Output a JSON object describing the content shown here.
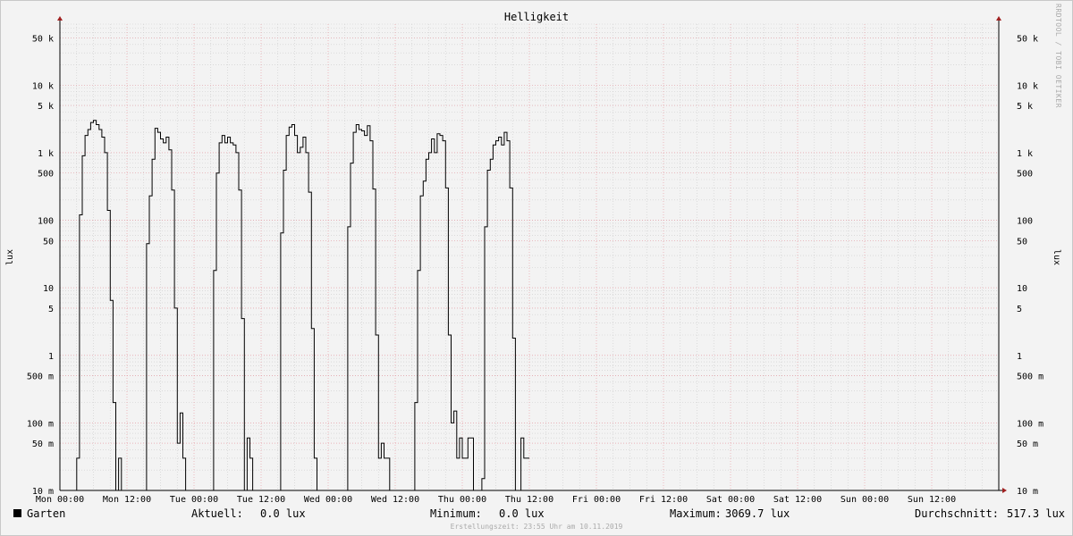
{
  "window": {
    "credit": "RRDTOOL / TOBI OETIKER",
    "footer": "Erstellungszeit: 23:55 Uhr am 10.11.2019"
  },
  "legend": {
    "series_name": "Garten",
    "current_label": "Aktuell:",
    "current_value": "0.0 lux",
    "min_label": "Minimum:",
    "min_value": "0.0 lux",
    "max_label": "Maximum:",
    "max_value": "3069.7 lux",
    "avg_label": "Durchschnitt:",
    "avg_value": "517.3 lux"
  },
  "chart_data": {
    "type": "line",
    "title": "Helligkeit",
    "ylabel": "lux",
    "yscale": "log",
    "ylim": [
      0.01,
      80000
    ],
    "xlim_hours": [
      0,
      168
    ],
    "ytick_values": [
      0.01,
      0.05,
      0.1,
      0.5,
      1,
      5,
      10,
      50,
      100,
      500,
      1000,
      5000,
      10000,
      50000
    ],
    "ytick_labels": [
      "10 m",
      "50 m",
      "100 m",
      "500 m",
      "1",
      "5",
      "10",
      "50",
      "100",
      "500",
      "1 k",
      "5 k",
      "10 k",
      "50 k"
    ],
    "xtick_values": [
      0,
      12,
      24,
      36,
      48,
      60,
      72,
      84,
      96,
      108,
      120,
      132,
      144,
      156
    ],
    "xtick_labels": [
      "Mon 00:00",
      "Mon 12:00",
      "Tue 00:00",
      "Tue 12:00",
      "Wed 00:00",
      "Wed 12:00",
      "Thu 00:00",
      "Thu 12:00",
      "Fri 00:00",
      "Fri 12:00",
      "Sat 00:00",
      "Sat 12:00",
      "Sun 00:00",
      "Sun 12:00"
    ],
    "grid": true,
    "colors": {
      "line": "#000000",
      "major_grid": "#e8a0a8",
      "minor_grid": "#cccccc",
      "axis": "#000000",
      "arrow": "#a02020"
    },
    "series": [
      {
        "name": "Garten",
        "points": [
          [
            0,
            0.01
          ],
          [
            3,
            0.01
          ],
          [
            3,
            0.03
          ],
          [
            3.5,
            0.03
          ],
          [
            3.5,
            120
          ],
          [
            4,
            120
          ],
          [
            4,
            900
          ],
          [
            4.5,
            900
          ],
          [
            4.5,
            1800
          ],
          [
            5,
            1800
          ],
          [
            5,
            2200
          ],
          [
            5.5,
            2200
          ],
          [
            5.5,
            2800
          ],
          [
            6,
            2800
          ],
          [
            6,
            3000
          ],
          [
            6.5,
            3000
          ],
          [
            6.5,
            2600
          ],
          [
            7,
            2600
          ],
          [
            7,
            2200
          ],
          [
            7.5,
            2200
          ],
          [
            7.5,
            1700
          ],
          [
            8,
            1700
          ],
          [
            8,
            1000
          ],
          [
            8.5,
            1000
          ],
          [
            8.5,
            140
          ],
          [
            9,
            140
          ],
          [
            9,
            6.5
          ],
          [
            9.5,
            6.5
          ],
          [
            9.5,
            0.2
          ],
          [
            10,
            0.2
          ],
          [
            10,
            0.01
          ],
          [
            10.5,
            0.01
          ],
          [
            10.5,
            0.03
          ],
          [
            11,
            0.03
          ],
          [
            11,
            0.01
          ],
          [
            15.5,
            0.01
          ],
          [
            15.5,
            45
          ],
          [
            16,
            45
          ],
          [
            16,
            230
          ],
          [
            16.5,
            230
          ],
          [
            16.5,
            800
          ],
          [
            17,
            800
          ],
          [
            17,
            2300
          ],
          [
            17.5,
            2300
          ],
          [
            17.5,
            2000
          ],
          [
            18,
            2000
          ],
          [
            18,
            1600
          ],
          [
            18.5,
            1600
          ],
          [
            18.5,
            1400
          ],
          [
            19,
            1400
          ],
          [
            19,
            1700
          ],
          [
            19.5,
            1700
          ],
          [
            19.5,
            1100
          ],
          [
            20,
            1100
          ],
          [
            20,
            280
          ],
          [
            20.5,
            280
          ],
          [
            20.5,
            5
          ],
          [
            21,
            5
          ],
          [
            21,
            0.05
          ],
          [
            21.5,
            0.05
          ],
          [
            21.5,
            0.14
          ],
          [
            22,
            0.14
          ],
          [
            22,
            0.03
          ],
          [
            22.5,
            0.03
          ],
          [
            22.5,
            0.01
          ],
          [
            27.5,
            0.01
          ],
          [
            27.5,
            18
          ],
          [
            28,
            18
          ],
          [
            28,
            500
          ],
          [
            28.5,
            500
          ],
          [
            28.5,
            1400
          ],
          [
            29,
            1400
          ],
          [
            29,
            1800
          ],
          [
            29.5,
            1800
          ],
          [
            29.5,
            1400
          ],
          [
            30,
            1400
          ],
          [
            30,
            1700
          ],
          [
            30.5,
            1700
          ],
          [
            30.5,
            1400
          ],
          [
            31,
            1400
          ],
          [
            31,
            1300
          ],
          [
            31.5,
            1300
          ],
          [
            31.5,
            1000
          ],
          [
            32,
            1000
          ],
          [
            32,
            280
          ],
          [
            32.5,
            280
          ],
          [
            32.5,
            3.5
          ],
          [
            33,
            3.5
          ],
          [
            33,
            0.01
          ],
          [
            33.5,
            0.01
          ],
          [
            33.5,
            0.06
          ],
          [
            34,
            0.06
          ],
          [
            34,
            0.03
          ],
          [
            34.5,
            0.03
          ],
          [
            34.5,
            0.01
          ],
          [
            39.5,
            0.01
          ],
          [
            39.5,
            65
          ],
          [
            40,
            65
          ],
          [
            40,
            550
          ],
          [
            40.5,
            550
          ],
          [
            40.5,
            1800
          ],
          [
            41,
            1800
          ],
          [
            41,
            2400
          ],
          [
            41.5,
            2400
          ],
          [
            41.5,
            2600
          ],
          [
            42,
            2600
          ],
          [
            42,
            1800
          ],
          [
            42.5,
            1800
          ],
          [
            42.5,
            1000
          ],
          [
            43,
            1000
          ],
          [
            43,
            1200
          ],
          [
            43.5,
            1200
          ],
          [
            43.5,
            1700
          ],
          [
            44,
            1700
          ],
          [
            44,
            1000
          ],
          [
            44.5,
            1000
          ],
          [
            44.5,
            260
          ],
          [
            45,
            260
          ],
          [
            45,
            2.5
          ],
          [
            45.5,
            2.5
          ],
          [
            45.5,
            0.03
          ],
          [
            46,
            0.03
          ],
          [
            46,
            0.01
          ],
          [
            51.5,
            0.01
          ],
          [
            51.5,
            80
          ],
          [
            52,
            80
          ],
          [
            52,
            700
          ],
          [
            52.5,
            700
          ],
          [
            52.5,
            2000
          ],
          [
            53,
            2000
          ],
          [
            53,
            2600
          ],
          [
            53.5,
            2600
          ],
          [
            53.5,
            2200
          ],
          [
            54,
            2200
          ],
          [
            54,
            2100
          ],
          [
            54.5,
            2100
          ],
          [
            54.5,
            1800
          ],
          [
            55,
            1800
          ],
          [
            55,
            2500
          ],
          [
            55.5,
            2500
          ],
          [
            55.5,
            1500
          ],
          [
            56,
            1500
          ],
          [
            56,
            290
          ],
          [
            56.5,
            290
          ],
          [
            56.5,
            2
          ],
          [
            57,
            2
          ],
          [
            57,
            0.03
          ],
          [
            57.5,
            0.03
          ],
          [
            57.5,
            0.05
          ],
          [
            58,
            0.05
          ],
          [
            58,
            0.03
          ],
          [
            59,
            0.03
          ],
          [
            59,
            0.01
          ],
          [
            63.5,
            0.01
          ],
          [
            63.5,
            0.2
          ],
          [
            64,
            0.2
          ],
          [
            64,
            18
          ],
          [
            64.5,
            18
          ],
          [
            64.5,
            230
          ],
          [
            65,
            230
          ],
          [
            65,
            380
          ],
          [
            65.5,
            380
          ],
          [
            65.5,
            800
          ],
          [
            66,
            800
          ],
          [
            66,
            1000
          ],
          [
            66.5,
            1000
          ],
          [
            66.5,
            1600
          ],
          [
            67,
            1600
          ],
          [
            67,
            1000
          ],
          [
            67.5,
            1000
          ],
          [
            67.5,
            1900
          ],
          [
            68,
            1900
          ],
          [
            68,
            1800
          ],
          [
            68.5,
            1800
          ],
          [
            68.5,
            1500
          ],
          [
            69,
            1500
          ],
          [
            69,
            300
          ],
          [
            69.5,
            300
          ],
          [
            69.5,
            2
          ],
          [
            70,
            2
          ],
          [
            70,
            0.1
          ],
          [
            70.5,
            0.1
          ],
          [
            70.5,
            0.15
          ],
          [
            71,
            0.15
          ],
          [
            71,
            0.03
          ],
          [
            71.5,
            0.03
          ],
          [
            71.5,
            0.06
          ],
          [
            72,
            0.06
          ],
          [
            72,
            0.03
          ],
          [
            73,
            0.03
          ],
          [
            73,
            0.06
          ],
          [
            74,
            0.06
          ],
          [
            74,
            0.01
          ],
          [
            75.5,
            0.01
          ],
          [
            75.5,
            0.015
          ],
          [
            76,
            0.015
          ],
          [
            76,
            80
          ],
          [
            76.5,
            80
          ],
          [
            76.5,
            550
          ],
          [
            77,
            550
          ],
          [
            77,
            800
          ],
          [
            77.5,
            800
          ],
          [
            77.5,
            1300
          ],
          [
            78,
            1300
          ],
          [
            78,
            1500
          ],
          [
            78.5,
            1500
          ],
          [
            78.5,
            1700
          ],
          [
            79,
            1700
          ],
          [
            79,
            1300
          ],
          [
            79.5,
            1300
          ],
          [
            79.5,
            2000
          ],
          [
            80,
            2000
          ],
          [
            80,
            1500
          ],
          [
            80.5,
            1500
          ],
          [
            80.5,
            300
          ],
          [
            81,
            300
          ],
          [
            81,
            1.8
          ],
          [
            81.5,
            1.8
          ],
          [
            81.5,
            0.01
          ],
          [
            82.5,
            0.01
          ],
          [
            82.5,
            0.06
          ],
          [
            83,
            0.06
          ],
          [
            83,
            0.03
          ],
          [
            84,
            0.03
          ]
        ]
      }
    ]
  }
}
